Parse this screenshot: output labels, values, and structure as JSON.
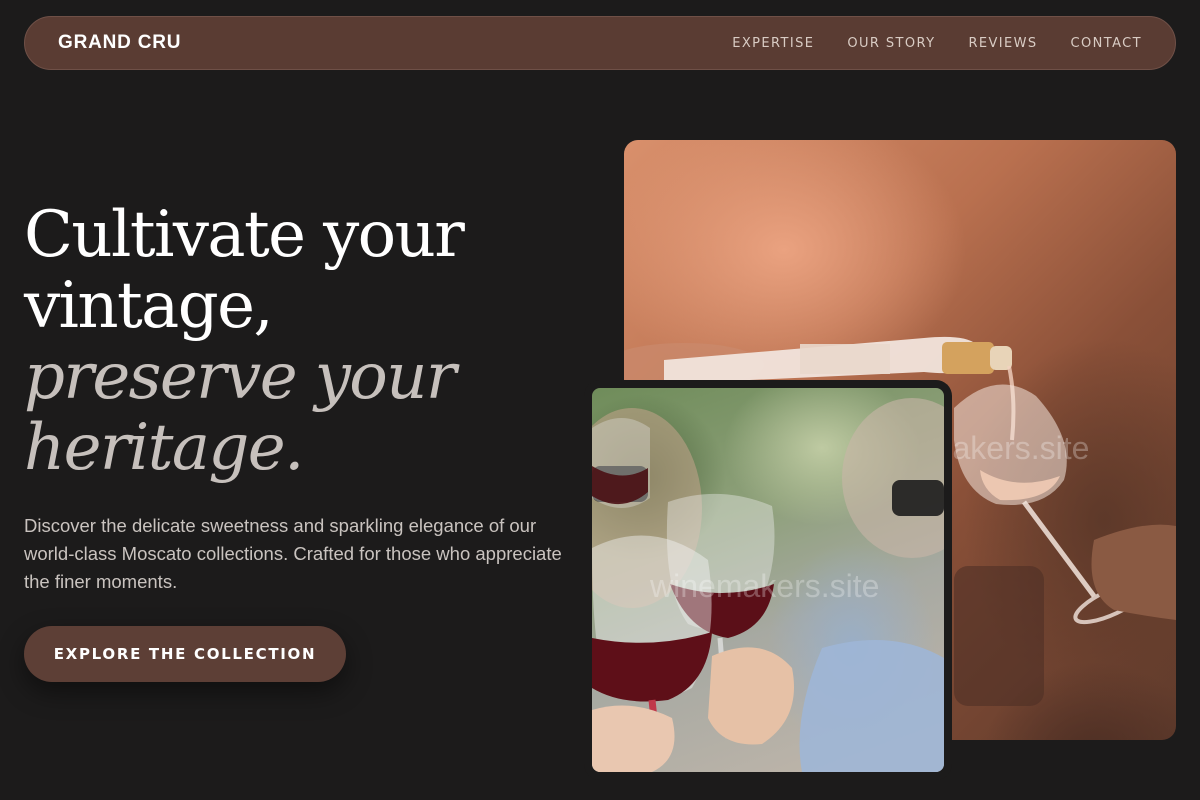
{
  "navbar": {
    "brand": "GRAND CRU",
    "links": [
      "EXPERTISE",
      "OUR STORY",
      "REVIEWS",
      "CONTACT"
    ]
  },
  "hero": {
    "title_line1": "Cultivate your",
    "title_line2": "vintage,",
    "title_line3": "preserve your",
    "title_line4": "heritage.",
    "description": "Discover the delicate sweetness and sparkling elegance of our world-class Moscato collections. Crafted for those who appreciate the finer moments.",
    "cta_label": "EXPLORE THE COLLECTION"
  },
  "images": {
    "large_watermark": "winemakers.site",
    "small_watermark": "winemakers.site"
  },
  "colors": {
    "background": "#1c1b1b",
    "accent": "#5a3c33",
    "heading": "#ffffff",
    "heading_italic": "#c6c0bc",
    "body_text": "#c9c3bf"
  }
}
